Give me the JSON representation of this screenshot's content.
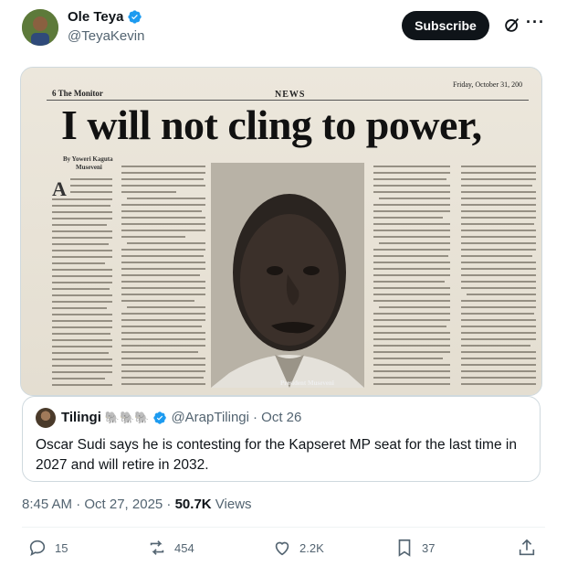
{
  "author": {
    "display_name": "Ole Teya",
    "handle": "@TeyaKevin"
  },
  "header": {
    "subscribe_label": "Subscribe",
    "more_label": "···"
  },
  "newspaper": {
    "section": "6 The Monitor",
    "label": "NEWS",
    "date": "Friday, October 31, 200",
    "headline": "I will not cling to power,",
    "byline_1": "By Yoweri Kaguta",
    "byline_2": "Museveni",
    "photo_caption": "President Museveni"
  },
  "quoted": {
    "display_name": "Tilingi",
    "emojis": "🐘🐘🐘",
    "handle": "@ArapTilingi",
    "date": "· Oct 26",
    "text": "Oscar Sudi says he is contesting for the Kapseret MP seat for the last time in 2027 and will retire in 2032."
  },
  "meta": {
    "time": "8:45 AM · Oct 27, 2025 · ",
    "views_count": "50.7K",
    "views_label": " Views"
  },
  "actions": {
    "replies": "15",
    "reposts": "454",
    "likes": "2.2K",
    "bookmarks": "37"
  },
  "colors": {
    "verified": "#1d9bf0",
    "text": "#0f1419",
    "muted": "#536471"
  }
}
